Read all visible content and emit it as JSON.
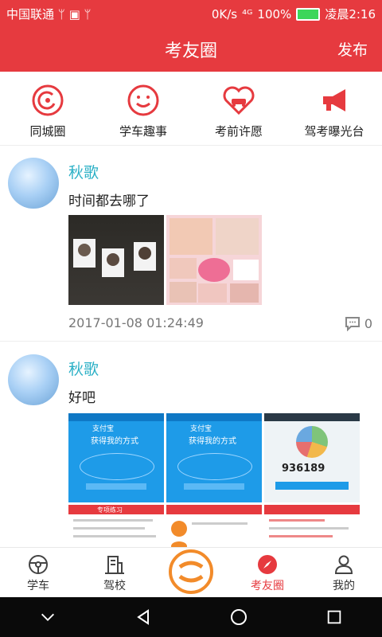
{
  "status": {
    "carrier": "中国联通",
    "left_icons": "ᛘ ▣ ᛘ",
    "speed": "0K/s",
    "signal": "⁴ᴳ",
    "battery": "100%",
    "time": "凌晨2:16"
  },
  "appbar": {
    "title": "考友圈",
    "publish": "发布"
  },
  "categories": [
    {
      "label": "同城圈",
      "icon": "target-icon"
    },
    {
      "label": "学车趣事",
      "icon": "smile-icon"
    },
    {
      "label": "考前许愿",
      "icon": "heart-car-icon"
    },
    {
      "label": "驾考曝光台",
      "icon": "megaphone-icon"
    }
  ],
  "posts": [
    {
      "name": "秋歌",
      "text": "时间都去哪了",
      "time": "2017-01-08 01:24:49",
      "comments": "0"
    },
    {
      "name": "秋歌",
      "text": "好吧",
      "big_number": "936189",
      "image_headers": [
        "支付宝",
        "获得我的方式",
        "专项练习"
      ]
    }
  ],
  "tabs": [
    {
      "label": "学车",
      "icon": "steering-wheel-icon"
    },
    {
      "label": "驾校",
      "icon": "building-icon"
    },
    {
      "label": "",
      "icon": "center-logo-icon"
    },
    {
      "label": "考友圈",
      "icon": "compass-icon"
    },
    {
      "label": "我的",
      "icon": "user-icon"
    }
  ],
  "colors": {
    "brand": "#e63a3f",
    "name": "#2bb0c6",
    "center": "#f28b2a"
  }
}
